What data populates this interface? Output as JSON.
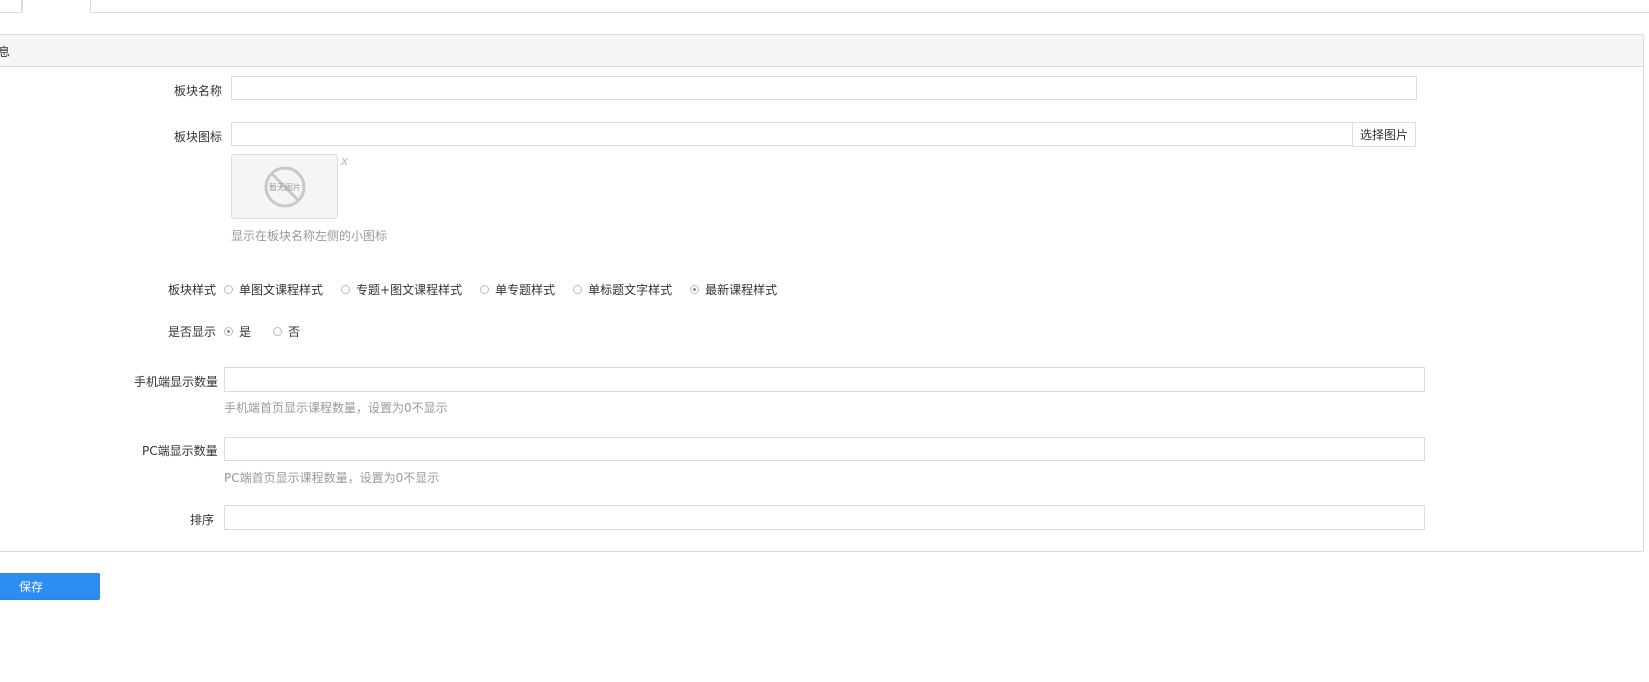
{
  "tabs": [
    {
      "label": ""
    },
    {
      "label": ""
    }
  ],
  "panel": {
    "title": "息"
  },
  "form": {
    "name": {
      "label": "板块名称",
      "value": ""
    },
    "icon": {
      "label": "板块图标",
      "value": "",
      "button": "选择图片",
      "thumb_text": "暂无图片",
      "remove": "x",
      "help": "显示在板块名称左侧的小图标"
    },
    "style": {
      "label": "板块样式",
      "options": [
        {
          "label": "单图文课程样式",
          "checked": false
        },
        {
          "label": "专题+图文课程样式",
          "checked": false
        },
        {
          "label": "单专题样式",
          "checked": false
        },
        {
          "label": "单标题文字样式",
          "checked": false
        },
        {
          "label": "最新课程样式",
          "checked": true
        }
      ]
    },
    "display": {
      "label": "是否显示",
      "options": [
        {
          "label": "是",
          "checked": true
        },
        {
          "label": "否",
          "checked": false
        }
      ]
    },
    "mobile_count": {
      "label": "手机端显示数量",
      "value": "",
      "help": "手机端首页显示课程数量，设置为0不显示"
    },
    "pc_count": {
      "label": "PC端显示数量",
      "value": "",
      "help": "PC端首页显示课程数量，设置为0不显示"
    },
    "sort": {
      "label": "排序",
      "value": ""
    }
  },
  "actions": {
    "save": "保存"
  },
  "colors": {
    "primary": "#2d8cf0",
    "border": "#dcdcdc",
    "heading_bg": "#f5f5f5",
    "help_text": "#999999"
  }
}
